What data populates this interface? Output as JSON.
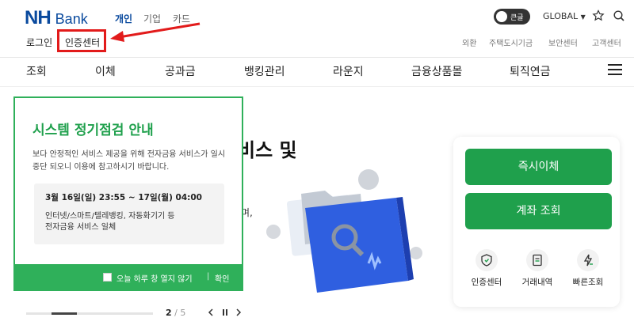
{
  "header": {
    "logo_nh": "NH",
    "logo_bank": "Bank",
    "categories": [
      "개인",
      "기업",
      "카드"
    ],
    "toggle_label": "큰글",
    "global": "GLOBAL",
    "login": "로그인",
    "cert_center": "인증센터",
    "utility": [
      "외환",
      "주택도시기금",
      "보안센터",
      "고객센터"
    ]
  },
  "nav": [
    "조회",
    "이체",
    "공과금",
    "뱅킹관리",
    "라운지",
    "금융상품몰",
    "퇴직연금"
  ],
  "hero": {
    "title_partial": "비스 및",
    "small_partial": "며,"
  },
  "popup": {
    "title": "시스템 정기점검 안내",
    "desc": "보다 안정적인 서비스 제공을 위해 전자금융 서비스가 일시 중단 되오니 이용에 참고하시기 바랍니다.",
    "schedule": "3월 16일(일) 23:55 ~ 17일(월) 04:00",
    "scope_line1": "인터넷/스마트/텔레뱅킹, 자동화기기 등",
    "scope_line2": "전자금융 서비스 일체",
    "dont_show": "오늘 하루 창 열지 않기",
    "confirm": "확인"
  },
  "quick": {
    "btn1": "즉시이체",
    "btn2": "계좌 조회",
    "items": [
      "인증센터",
      "거래내역",
      "빠른조회"
    ]
  },
  "pager": {
    "current": "2",
    "total": "/ 5",
    "progress": 0.4
  },
  "colors": {
    "brand_blue": "#0a4a9e",
    "green": "#1fa04c",
    "highlight_red": "#e21b1b"
  }
}
